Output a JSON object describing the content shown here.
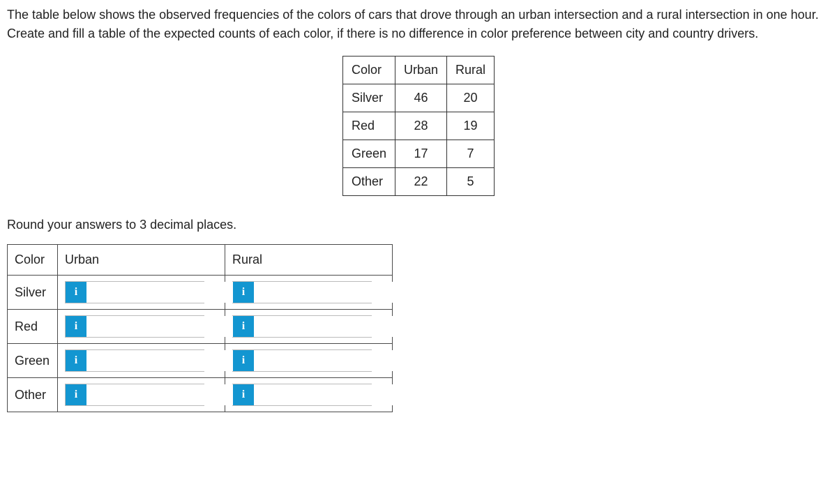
{
  "prompt": "The table below shows the observed frequencies of the colors of cars that drove through an urban intersection and a rural intersection in one hour. Create and fill a table of the expected counts of each color, if there is no difference in color preference between city and country drivers.",
  "observed": {
    "headers": {
      "c0": "Color",
      "c1": "Urban",
      "c2": "Rural"
    },
    "rows": [
      {
        "color": "Silver",
        "urban": "46",
        "rural": "20"
      },
      {
        "color": "Red",
        "urban": "28",
        "rural": "19"
      },
      {
        "color": "Green",
        "urban": "17",
        "rural": "7"
      },
      {
        "color": "Other",
        "urban": "22",
        "rural": "5"
      }
    ]
  },
  "round_note": "Round your answers to 3 decimal places.",
  "answer": {
    "headers": {
      "c0": "Color",
      "c1": "Urban",
      "c2": "Rural"
    },
    "rows": [
      {
        "color": "Silver"
      },
      {
        "color": "Red"
      },
      {
        "color": "Green"
      },
      {
        "color": "Other"
      }
    ]
  },
  "icons": {
    "info": "i"
  }
}
